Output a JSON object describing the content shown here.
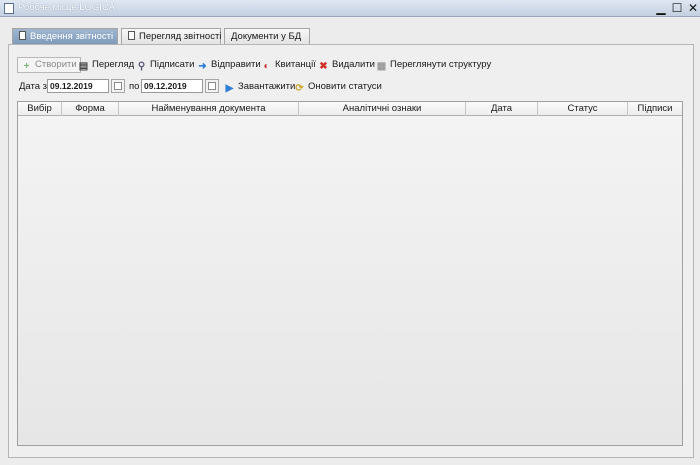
{
  "window": {
    "title": "Робоче місце LOGICA",
    "minimize": "▁",
    "maximize": "☐",
    "close": "✕"
  },
  "tabs": [
    {
      "label": "Введення звітності",
      "active": true
    },
    {
      "label": "Перегляд звітності",
      "active": false
    },
    {
      "label": "Документи у БД",
      "active": false
    }
  ],
  "toolbar": {
    "create": "Створити",
    "view": "Перегляд",
    "sign": "Підписати",
    "send": "Відправити",
    "receipts": "Квитанції",
    "delete": "Видалити",
    "structure": "Переглянути структуру"
  },
  "datebar": {
    "from_label": "Дата з",
    "from_value": "09.12.2019",
    "to_label": "по",
    "to_value": "09.12.2019",
    "load": "Завантажити",
    "refresh": "Оновити статуси"
  },
  "table": {
    "columns": [
      "Вибір",
      "Форма",
      "Найменування документа",
      "Аналітичні ознаки",
      "Дата",
      "Статус",
      "Підписи"
    ]
  }
}
